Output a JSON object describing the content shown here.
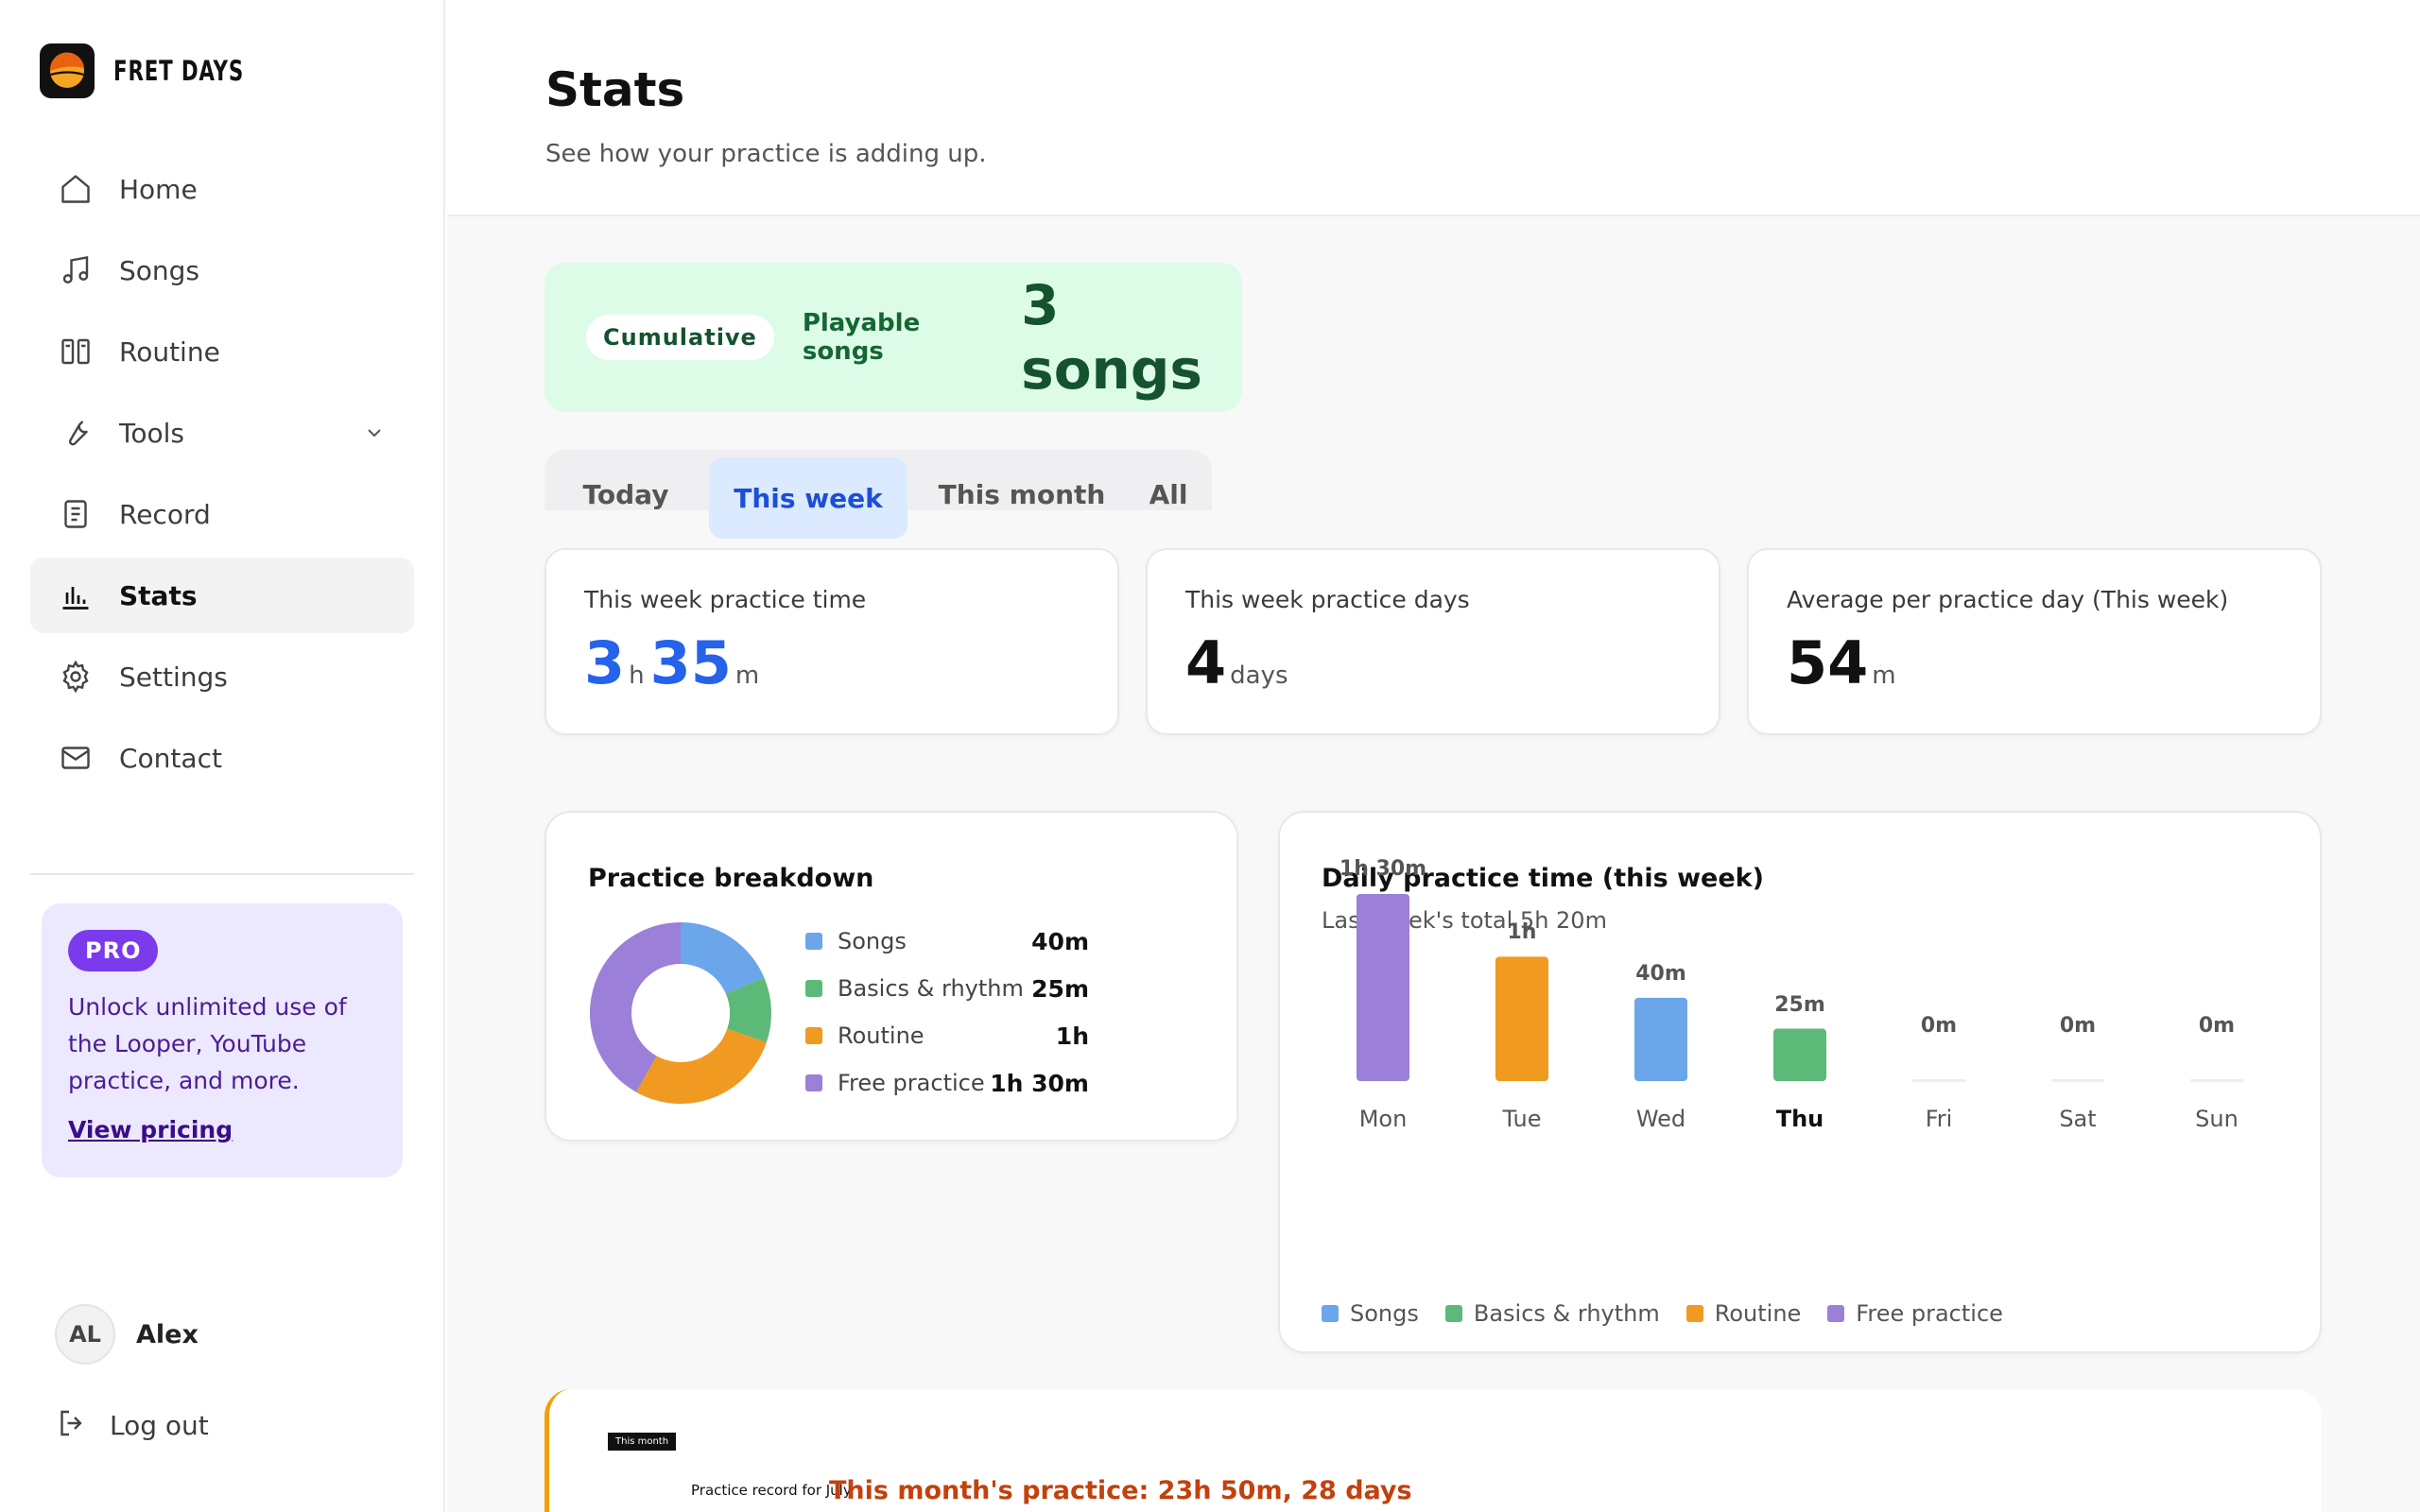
{
  "brand": {
    "name": "FRET DAYS"
  },
  "nav": {
    "items": [
      {
        "label": "Home",
        "icon": "home-icon"
      },
      {
        "label": "Songs",
        "icon": "music-note-icon"
      },
      {
        "label": "Routine",
        "icon": "columns-icon"
      },
      {
        "label": "Tools",
        "icon": "wrench-icon"
      },
      {
        "label": "Record",
        "icon": "clipboard-icon"
      },
      {
        "label": "Stats",
        "icon": "bar-chart-icon",
        "active": true
      },
      {
        "label": "Settings",
        "icon": "gear-icon"
      },
      {
        "label": "Contact",
        "icon": "mail-icon"
      }
    ]
  },
  "pro": {
    "badge": "PRO",
    "text": "Unlock unlimited use of the Looper, YouTube practice, and more.",
    "link": "View pricing"
  },
  "user": {
    "initials": "AL",
    "name": "Alex",
    "logout": "Log out"
  },
  "header": {
    "title": "Stats",
    "subtitle": "See how your practice is adding up."
  },
  "cumulative": {
    "chip": "Cumulative",
    "label": "Playable songs",
    "value": "3 songs"
  },
  "tabs": [
    "Today",
    "This week",
    "This month",
    "All"
  ],
  "active_tab": "This week",
  "stats": {
    "time": {
      "label": "This week practice time",
      "hours": "3",
      "h": "h",
      "minutes": "35",
      "m": "m"
    },
    "days": {
      "label": "This week practice days",
      "value": "4",
      "unit": "days"
    },
    "avg": {
      "label": "Average per practice day (This week)",
      "value": "54",
      "unit": "m"
    }
  },
  "colors": {
    "songs": "#6ba5ea",
    "basics": "#5cb978",
    "routine": "#f09a22",
    "free": "#9b7fd8"
  },
  "breakdown": {
    "title": "Practice breakdown",
    "items": [
      {
        "name": "Songs",
        "value": "40m"
      },
      {
        "name": "Basics & rhythm",
        "value": "25m"
      },
      {
        "name": "Routine",
        "value": "1h"
      },
      {
        "name": "Free practice",
        "value": "1h 30m"
      }
    ]
  },
  "daily": {
    "title": "Daily practice time (this week)",
    "last_week": "Last week's total 5h 20m",
    "legend": [
      "Songs",
      "Basics & rhythm",
      "Routine",
      "Free practice"
    ]
  },
  "chart_data": [
    {
      "type": "pie",
      "title": "Practice breakdown",
      "categories": [
        "Songs",
        "Basics & rhythm",
        "Routine",
        "Free practice"
      ],
      "values": [
        40,
        25,
        60,
        90
      ]
    },
    {
      "type": "bar",
      "title": "Daily practice time (this week)",
      "categories": [
        "Mon",
        "Tue",
        "Wed",
        "Thu",
        "Fri",
        "Sat",
        "Sun"
      ],
      "values": [
        90,
        60,
        40,
        25,
        0,
        0,
        0
      ],
      "value_labels": [
        "1h 30m",
        "1h",
        "40m",
        "25m",
        "0m",
        "0m",
        "0m"
      ],
      "bar_categories": [
        "free",
        "routine",
        "songs",
        "basics",
        null,
        null,
        null
      ],
      "highlight": "Thu"
    }
  ],
  "record": {
    "chip": "This month",
    "label": "Practice record for July",
    "summary": "This month's practice: 23h 50m, 28 days"
  }
}
